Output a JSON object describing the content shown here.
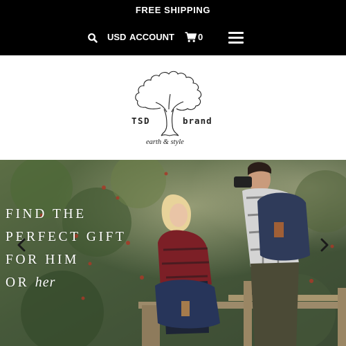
{
  "announcement": {
    "text": "FREE SHIPPING"
  },
  "nav": {
    "search_icon": "search-icon",
    "currency": "USD",
    "account": "ACCOUNT",
    "cart_icon": "shopping-cart-icon",
    "cart_count": "0",
    "menu_icon": "hamburger-menu-icon"
  },
  "logo": {
    "brand_left": "TSD",
    "brand_right": "brand",
    "tagline": "earth & style",
    "icon": "tree-logo-icon"
  },
  "hero": {
    "lines": [
      "FIND THE",
      "PERFECT GIFT",
      "FOR HIM",
      "OR"
    ],
    "script_word": "her",
    "prev_icon": "chevron-left-icon",
    "next_icon": "chevron-right-icon"
  },
  "colors": {
    "topbar": "#000000",
    "text_light": "#ffffff",
    "logo_ink": "#222222"
  }
}
